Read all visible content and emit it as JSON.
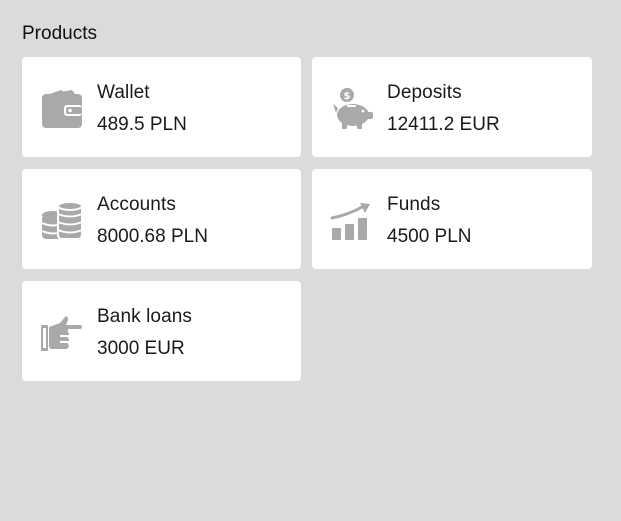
{
  "section": {
    "title": "Products"
  },
  "colors": {
    "background": "#dadbdb",
    "card": "#ffffff",
    "icon": "#a9a9a9",
    "text": "#1a1a1a"
  },
  "products": [
    {
      "name": "Wallet",
      "amount": "489.5 PLN",
      "icon": "wallet-icon"
    },
    {
      "name": "Deposits",
      "amount": "12411.2 EUR",
      "icon": "piggy-bank-icon"
    },
    {
      "name": "Accounts",
      "amount": "8000.68 PLN",
      "icon": "coins-icon"
    },
    {
      "name": "Funds",
      "amount": "4500 PLN",
      "icon": "growth-chart-icon"
    },
    {
      "name": "Bank loans",
      "amount": "3000 EUR",
      "icon": "hand-pointing-icon"
    }
  ]
}
